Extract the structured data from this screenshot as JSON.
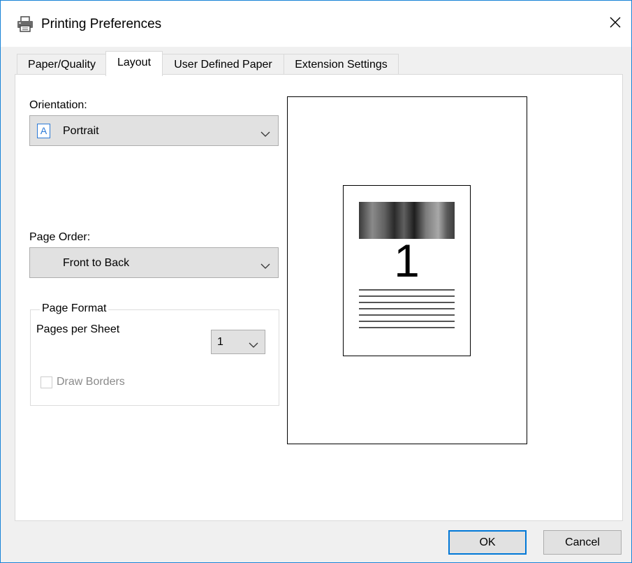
{
  "window": {
    "title": "Printing Preferences",
    "title_icon": "printer-icon",
    "close_icon": "close-icon"
  },
  "tabs": [
    {
      "label": "Paper/Quality",
      "active": false
    },
    {
      "label": "Layout",
      "active": true
    },
    {
      "label": "User Defined Paper",
      "active": false
    },
    {
      "label": "Extension Settings",
      "active": false
    }
  ],
  "layout": {
    "orientation": {
      "label": "Orientation:",
      "icon_letter": "A",
      "value": "Portrait"
    },
    "page_order": {
      "label": "Page Order:",
      "value": "Front to Back"
    },
    "page_format": {
      "legend": "Page Format",
      "pages_per_sheet_label": "Pages per Sheet",
      "pages_per_sheet_value": "1",
      "draw_borders_label": "Draw Borders",
      "draw_borders_checked": false,
      "draw_borders_enabled": false
    },
    "preview": {
      "page_number": "1",
      "text_line_count": 7
    }
  },
  "buttons": {
    "ok": "OK",
    "cancel": "Cancel"
  },
  "colors": {
    "accent": "#0078d7",
    "window_border": "#1883d7",
    "dialog_bg": "#f0f0f0",
    "disabled_text": "#8a8a8a"
  }
}
